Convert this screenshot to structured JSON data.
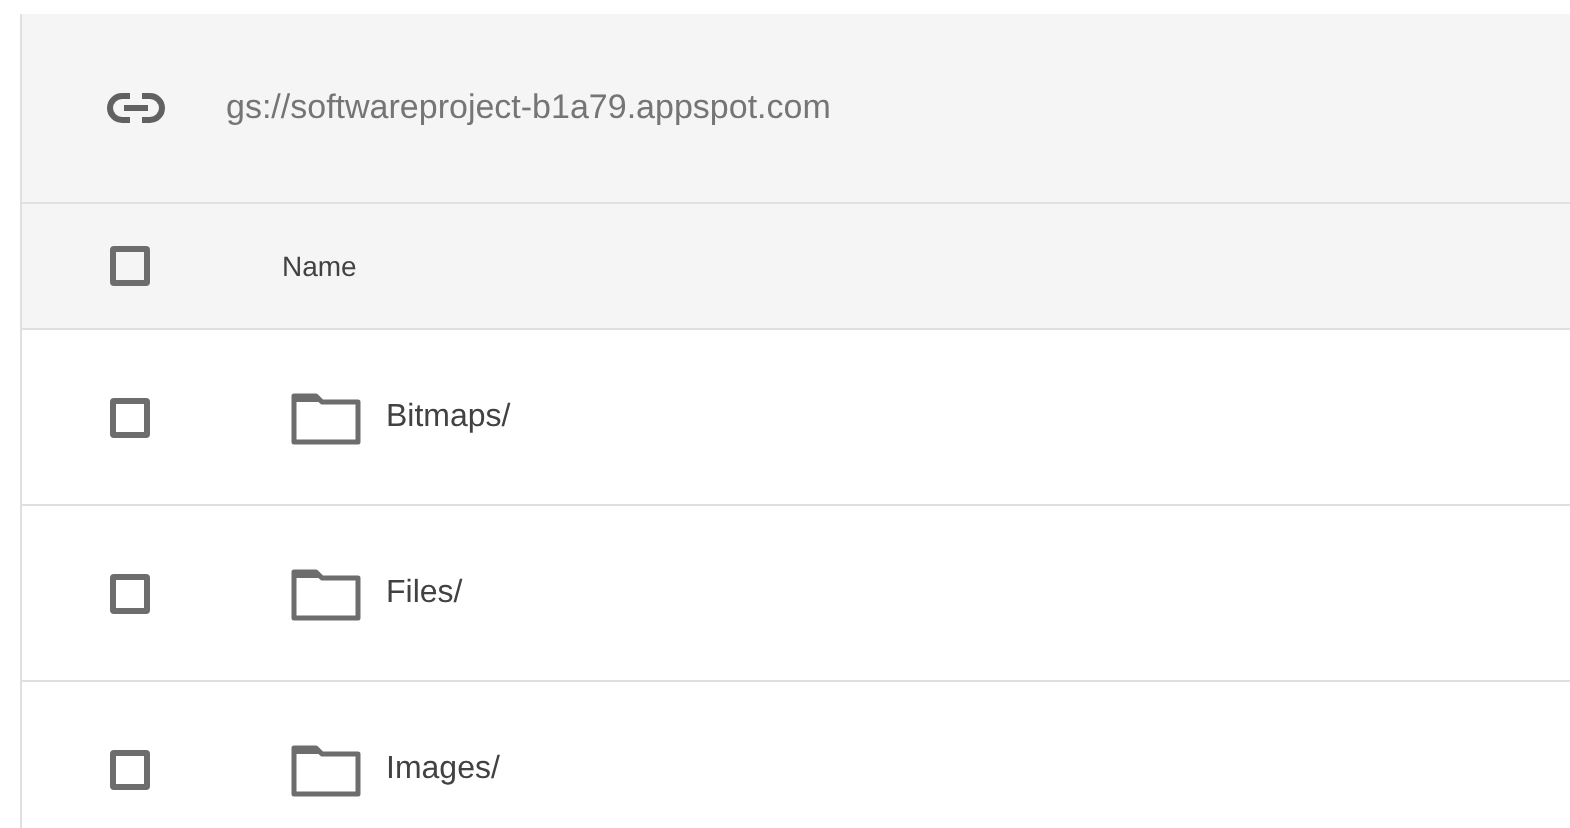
{
  "bucket": {
    "path": "gs://softwareproject-b1a79.appspot.com"
  },
  "table": {
    "header": {
      "checked": false,
      "label": "Name"
    },
    "rows": [
      {
        "name": "Bitmaps/",
        "kind": "folder",
        "checked": false
      },
      {
        "name": "Files/",
        "kind": "folder",
        "checked": false
      },
      {
        "name": "Images/",
        "kind": "folder",
        "checked": false
      }
    ]
  }
}
